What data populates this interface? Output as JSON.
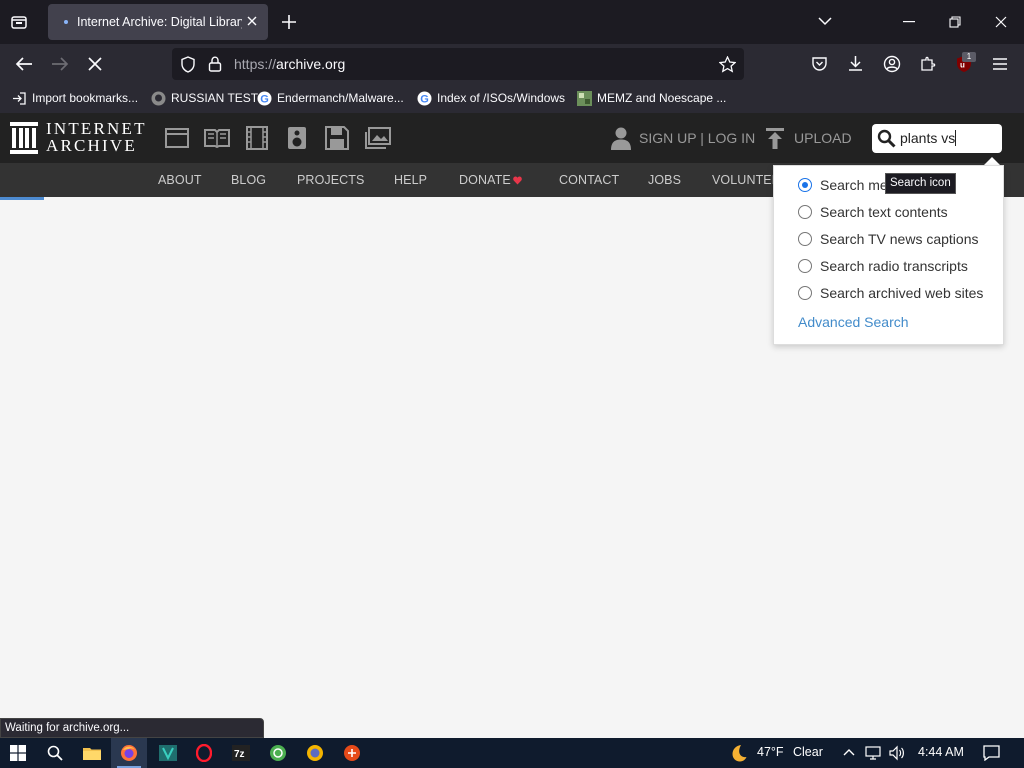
{
  "browser": {
    "tab_title": "Internet Archive: Digital Library",
    "url_scheme": "https://",
    "url_host": "archive.org",
    "extension_badge": "1",
    "bookmarks": [
      {
        "label": "Import bookmarks...",
        "icon": "import-icon"
      },
      {
        "label": "RUSSIAN TEST",
        "icon": "github-icon"
      },
      {
        "label": "Endermanch/Malware...",
        "icon": "google-icon"
      },
      {
        "label": "Index of /ISOs/Windows",
        "icon": "google-icon"
      },
      {
        "label": "MEMZ and Noescape ...",
        "icon": "image-thumbnail-icon"
      }
    ]
  },
  "site": {
    "logo_line1": "INTERNET",
    "logo_line2": "ARCHIVE",
    "media_icons": [
      "web-icon",
      "texts-icon",
      "video-icon",
      "audio-icon",
      "software-icon",
      "images-icon"
    ],
    "signup_login": "SIGN UP | LOG IN",
    "upload": "UPLOAD",
    "search_value": "plants vs",
    "nav": [
      "ABOUT",
      "BLOG",
      "PROJECTS",
      "HELP",
      "DONATE",
      "CONTACT",
      "JOBS",
      "VOLUNTEER"
    ],
    "donate_dot_color": "#e8364a"
  },
  "search_dropdown": {
    "options": [
      {
        "label": "Search metadata",
        "selected": true
      },
      {
        "label": "Search text contents",
        "selected": false
      },
      {
        "label": "Search TV news captions",
        "selected": false
      },
      {
        "label": "Search radio transcripts",
        "selected": false
      },
      {
        "label": "Search archived web sites",
        "selected": false
      }
    ],
    "advanced": "Advanced Search",
    "tooltip": "Search icon"
  },
  "status": "Waiting for archive.org...",
  "taskbar": {
    "weather_temp": "47°F",
    "weather_desc": "Clear",
    "time": "4:44 AM"
  },
  "colors": {
    "accent": "#428bca",
    "radio_selected": "#1a73e8",
    "header_bg": "#222222",
    "nav_bg": "#333333"
  }
}
